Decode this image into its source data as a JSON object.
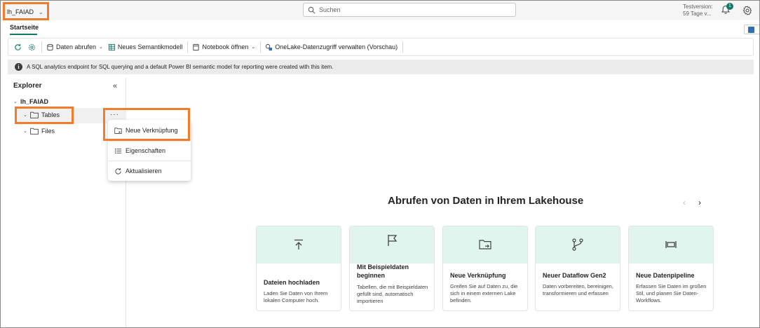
{
  "workspace": {
    "name": "lh_FAIAD"
  },
  "search": {
    "placeholder": "Suchen"
  },
  "trial": {
    "line1": "Testversion:",
    "line2": "59 Tage v..."
  },
  "notifications": {
    "count": "1"
  },
  "tabs": {
    "home": "Startseite"
  },
  "toolbar": {
    "get_data": "Daten abrufen",
    "new_semantic_model": "Neues Semantikmodell",
    "open_notebook": "Notebook öffnen",
    "onelake_access": "OneLake-Datenzugriff verwalten (Vorschau)"
  },
  "info": {
    "message": "A SQL analytics endpoint for SQL querying and a default Power BI semantic model for reporting were created with this item."
  },
  "explorer": {
    "title": "Explorer",
    "root": "lh_FAIAD",
    "tables": "Tables",
    "files": "Files"
  },
  "context_menu": {
    "more": "···",
    "items": [
      "Neue Verknüpfung",
      "Eigenschaften",
      "Aktualisieren"
    ]
  },
  "main": {
    "title": "Abrufen von Daten in Ihrem Lakehouse",
    "cards": [
      {
        "title": "Dateien hochladen",
        "desc": "Laden Sie Daten von Ihrem lokalen Computer hoch."
      },
      {
        "title": "Mit Beispieldaten beginnen",
        "desc": "Tabellen, die mit Beispieldaten gefüllt sind, automatisch importieren"
      },
      {
        "title": "Neue Verknüpfung",
        "desc": "Greifen Sie auf Daten zu, die sich in einem externen Lake befinden."
      },
      {
        "title": "Neuer Dataflow Gen2",
        "desc": "Daten vorbereiten, bereinigen, transformieren und erfassen"
      },
      {
        "title": "Neue Datenpipeline",
        "desc": "Erfassen Sie Daten im großen Stil, und planen Sie Daten-Workflows."
      }
    ]
  },
  "colors": {
    "accent": "#117865",
    "highlight": "#ef7d2b",
    "card_top": "#e0f5ee"
  }
}
